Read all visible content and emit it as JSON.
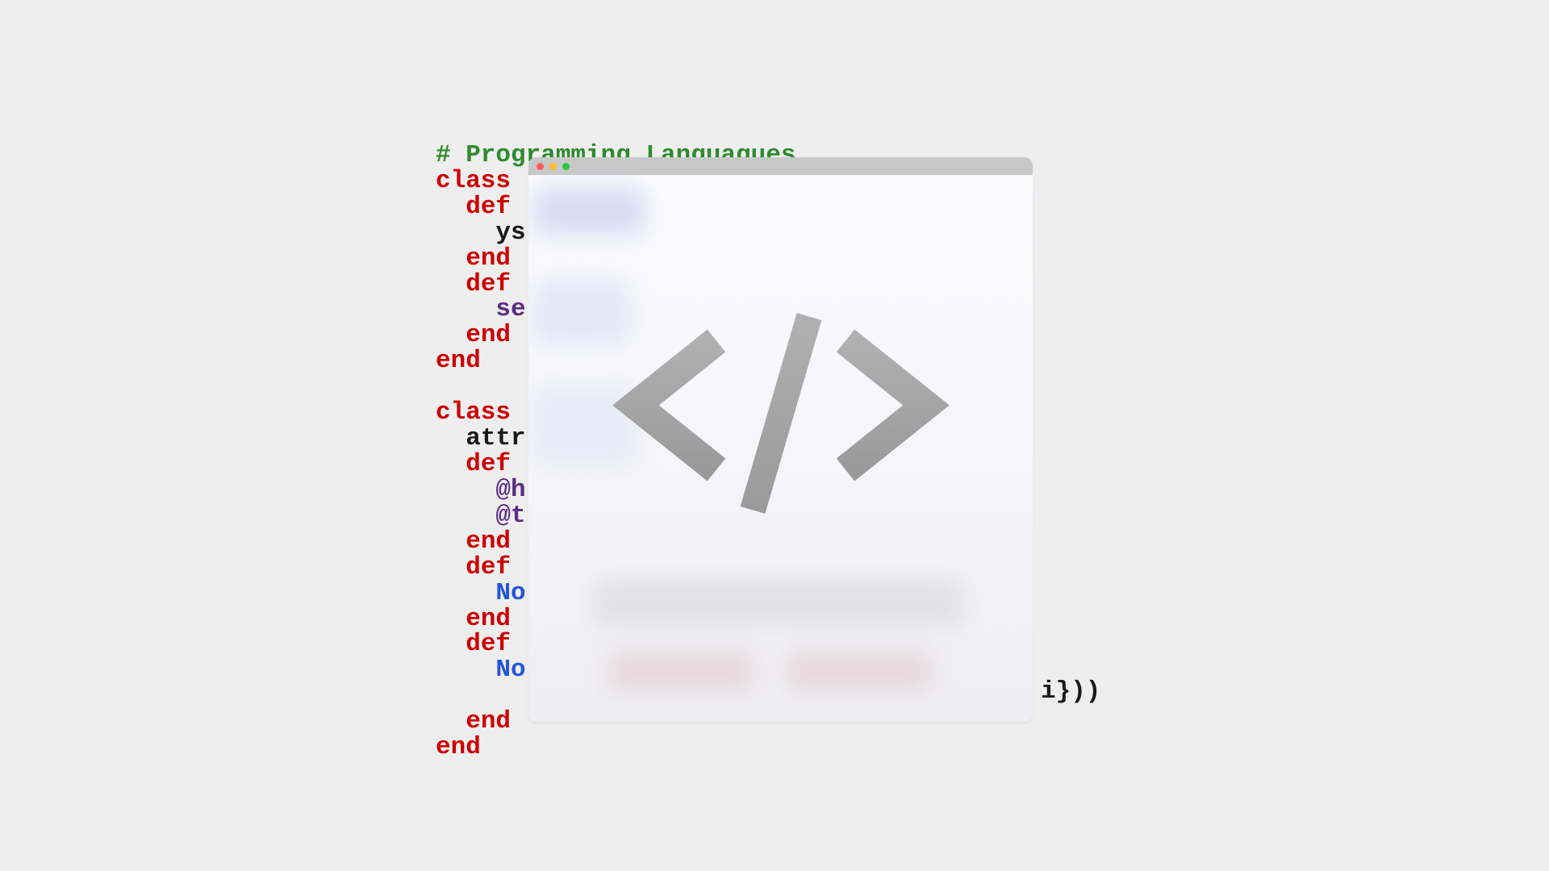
{
  "code": {
    "comment": "# Programming Languagues",
    "lines": [
      {
        "indent": 0,
        "tokens": [
          {
            "t": "keyword",
            "v": "class"
          }
        ]
      },
      {
        "indent": 1,
        "tokens": [
          {
            "t": "keyword",
            "v": "def"
          }
        ]
      },
      {
        "indent": 2,
        "tokens": [
          {
            "t": "ident",
            "v": "ys"
          }
        ]
      },
      {
        "indent": 1,
        "tokens": [
          {
            "t": "keyword",
            "v": "end"
          }
        ]
      },
      {
        "indent": 1,
        "tokens": [
          {
            "t": "keyword",
            "v": "def"
          }
        ]
      },
      {
        "indent": 2,
        "tokens": [
          {
            "t": "ivar",
            "v": "se"
          }
        ]
      },
      {
        "indent": 1,
        "tokens": [
          {
            "t": "keyword",
            "v": "end"
          }
        ]
      },
      {
        "indent": 0,
        "tokens": [
          {
            "t": "keyword",
            "v": "end"
          }
        ]
      },
      {
        "indent": 0,
        "tokens": []
      },
      {
        "indent": 0,
        "tokens": [
          {
            "t": "keyword",
            "v": "class"
          }
        ]
      },
      {
        "indent": 1,
        "tokens": [
          {
            "t": "ident",
            "v": "attr"
          }
        ]
      },
      {
        "indent": 1,
        "tokens": [
          {
            "t": "keyword",
            "v": "def"
          }
        ]
      },
      {
        "indent": 2,
        "tokens": [
          {
            "t": "ivar",
            "v": "@h"
          }
        ]
      },
      {
        "indent": 2,
        "tokens": [
          {
            "t": "ivar",
            "v": "@t"
          }
        ]
      },
      {
        "indent": 1,
        "tokens": [
          {
            "t": "keyword",
            "v": "end"
          }
        ]
      },
      {
        "indent": 1,
        "tokens": [
          {
            "t": "keyword",
            "v": "def"
          }
        ]
      },
      {
        "indent": 2,
        "tokens": [
          {
            "t": "const",
            "v": "No"
          }
        ]
      },
      {
        "indent": 1,
        "tokens": [
          {
            "t": "keyword",
            "v": "end"
          }
        ]
      },
      {
        "indent": 1,
        "tokens": [
          {
            "t": "keyword",
            "v": "def"
          }
        ]
      },
      {
        "indent": 2,
        "tokens": [
          {
            "t": "const",
            "v": "No"
          }
        ]
      },
      {
        "indent": 0,
        "tokens": []
      },
      {
        "indent": 1,
        "tokens": [
          {
            "t": "keyword",
            "v": "end"
          }
        ]
      },
      {
        "indent": 0,
        "tokens": [
          {
            "t": "keyword",
            "v": "end"
          }
        ]
      }
    ],
    "trailing": "i}))"
  },
  "window": {
    "icon_name": "code-brackets"
  }
}
